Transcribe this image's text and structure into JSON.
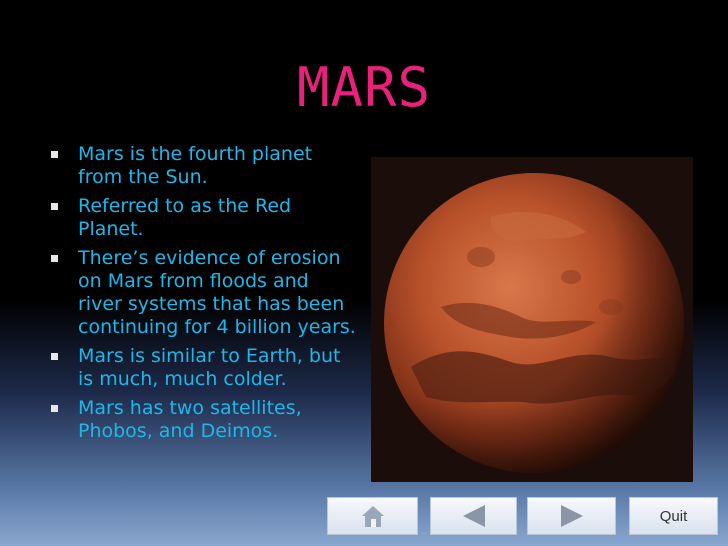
{
  "slide": {
    "title": "MARS",
    "bullets": [
      "Mars is the fourth planet from the Sun.",
      "Referred to as the Red Planet.",
      "There’s evidence of erosion on Mars from floods and river systems that has been continuing for 4 billion years.",
      "Mars is similar to Earth, but is much, much colder.",
      "Mars has two satellites, Phobos, and Deimos."
    ]
  },
  "nav": {
    "home_icon": "home-icon",
    "prev_icon": "arrow-left-icon",
    "next_icon": "arrow-right-icon",
    "quit_label": "Quit"
  },
  "colors": {
    "title": "#e8217a",
    "bullet_text": "#1fb7ea"
  }
}
